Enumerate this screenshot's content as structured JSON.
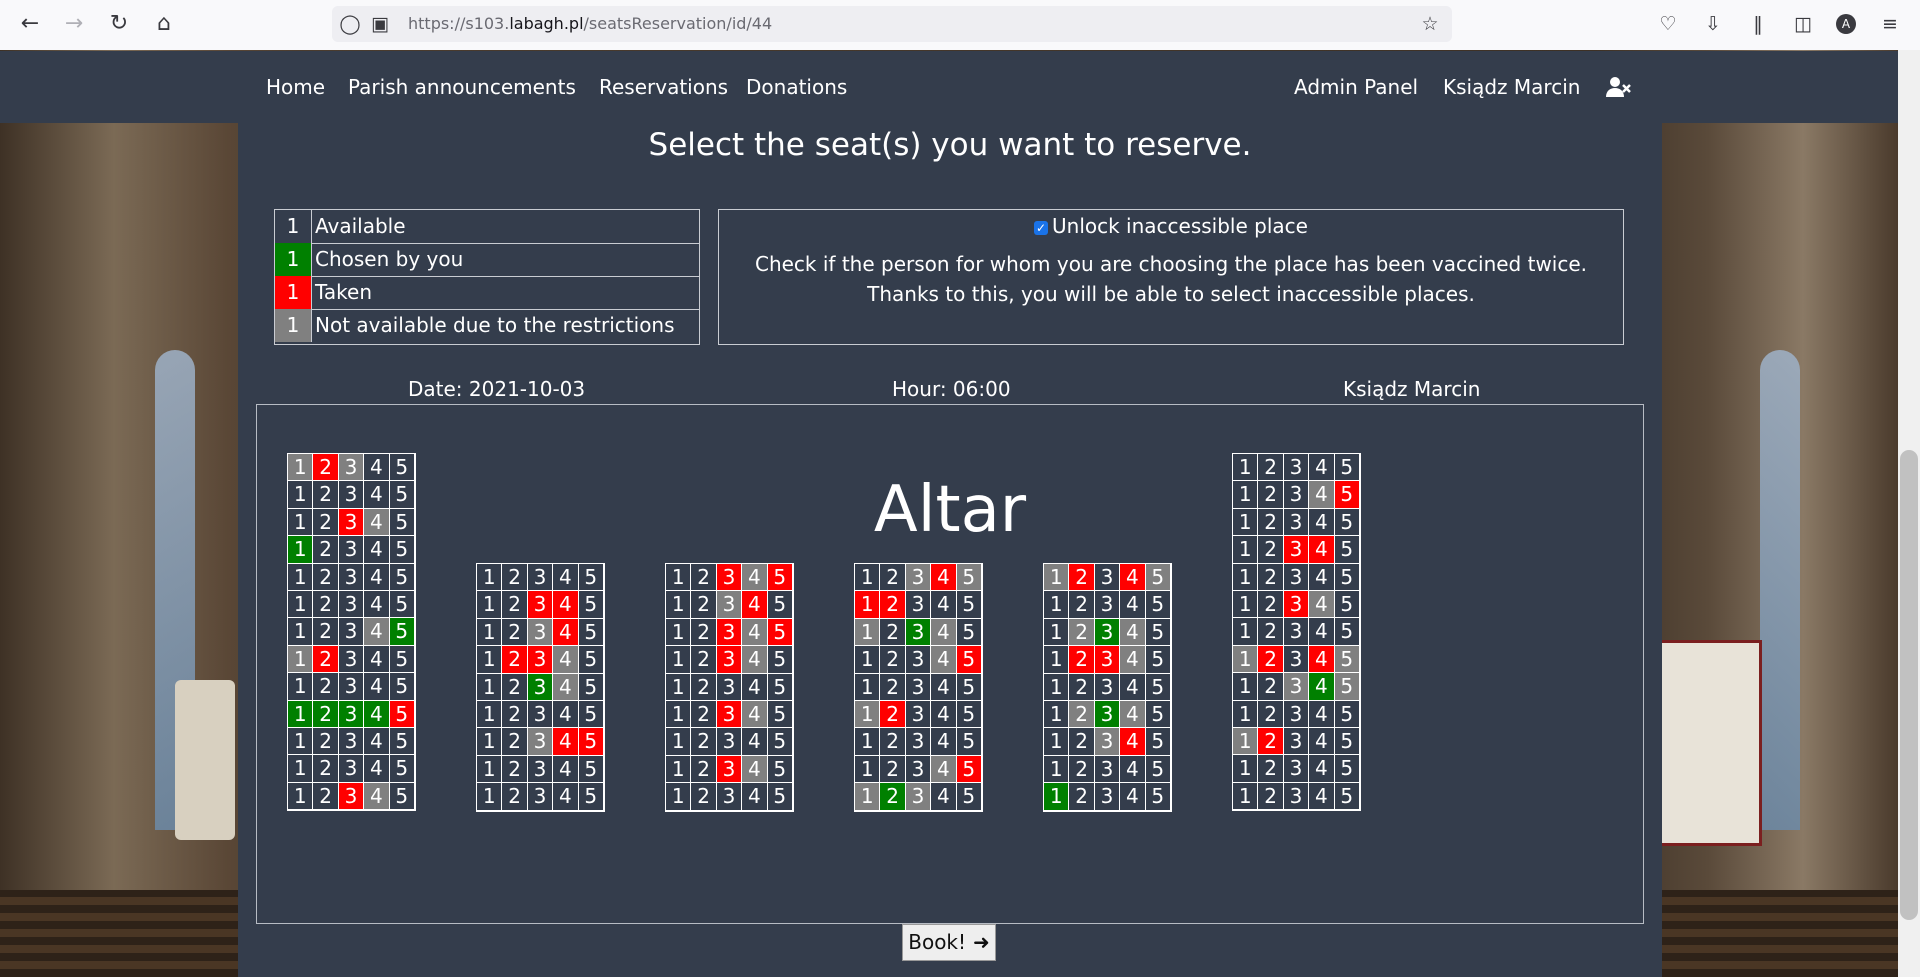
{
  "browser": {
    "url_prefix": "https://s103.",
    "url_domain": "labagh.pl",
    "url_path": "/seatsReservation/id/44",
    "profile_initial": "A"
  },
  "navbar": {
    "left": [
      "Home",
      "Parish announcements",
      "Reservations",
      "Donations"
    ],
    "admin_panel": "Admin Panel",
    "user_name": "Ksiądz Marcin"
  },
  "page": {
    "title": "Select the seat(s) you want to reserve.",
    "legend": [
      {
        "num": "1",
        "label": "Available",
        "state": "available"
      },
      {
        "num": "1",
        "label": "Chosen by you",
        "state": "chosen"
      },
      {
        "num": "1",
        "label": "Taken",
        "state": "taken"
      },
      {
        "num": "1",
        "label": "Not available due to the restrictions",
        "state": "restricted"
      }
    ],
    "unlock_label": "Unlock inaccessible place",
    "unlock_checked": true,
    "info_line1": "Check if the person for whom you are choosing the place has been vaccined twice.",
    "info_line2": "Thanks to this, you will be able to select inaccessible places.",
    "date": "Date: 2021-10-03",
    "hour": "Hour: 06:00",
    "priest": "Ksiądz Marcin",
    "altar": "Altar",
    "book_label": "Book!"
  },
  "colors": {
    "available": "#343d4c",
    "chosen": "#008000",
    "taken": "#ff0000",
    "restricted": "#808080"
  },
  "seat_numbers": [
    "1",
    "2",
    "3",
    "4",
    "5"
  ],
  "blocks": [
    {
      "rows": [
        "rtraa",
        "aaaaa",
        "aatra",
        "cgaaa",
        "aaaaa",
        "aaaaa",
        "aaarc",
        "rtaaa",
        "aaaaa",
        "cccct",
        "aaaaa",
        "aaaaa",
        "agtra"
      ]
    },
    {
      "rows": [
        "aaaaa",
        "agtta",
        "aarta",
        "attra",
        "agcra",
        "aaaaa",
        "aartt",
        "aaaaa",
        "aaaaa"
      ]
    },
    {
      "rows": [
        "agtrt",
        "aarta",
        "aatrt",
        "aatra",
        "aaaaa",
        "agtra",
        "aaaaa",
        "agtra",
        "aaaaa"
      ]
    },
    {
      "rows": [
        "aartr",
        "ttaaa",
        "rgcra",
        "aaart",
        "aaaaa",
        "rtaaa",
        "aaaaa",
        "aaart",
        "rcraa"
      ]
    },
    {
      "rows": [
        "rtatr",
        "aaaaa",
        "arcra",
        "attra",
        "aaaaa",
        "arcra",
        "aarta",
        "aaaaa",
        "cgaaa"
      ]
    },
    {
      "rows": [
        "aaaaa",
        "aaart",
        "aaaaa",
        "agtta",
        "aaaaa",
        "agtra",
        "aaaaa",
        "rtatr",
        "aarcr",
        "aaaaa",
        "rtaaa",
        "aaaaa",
        "aaaaa"
      ]
    }
  ]
}
